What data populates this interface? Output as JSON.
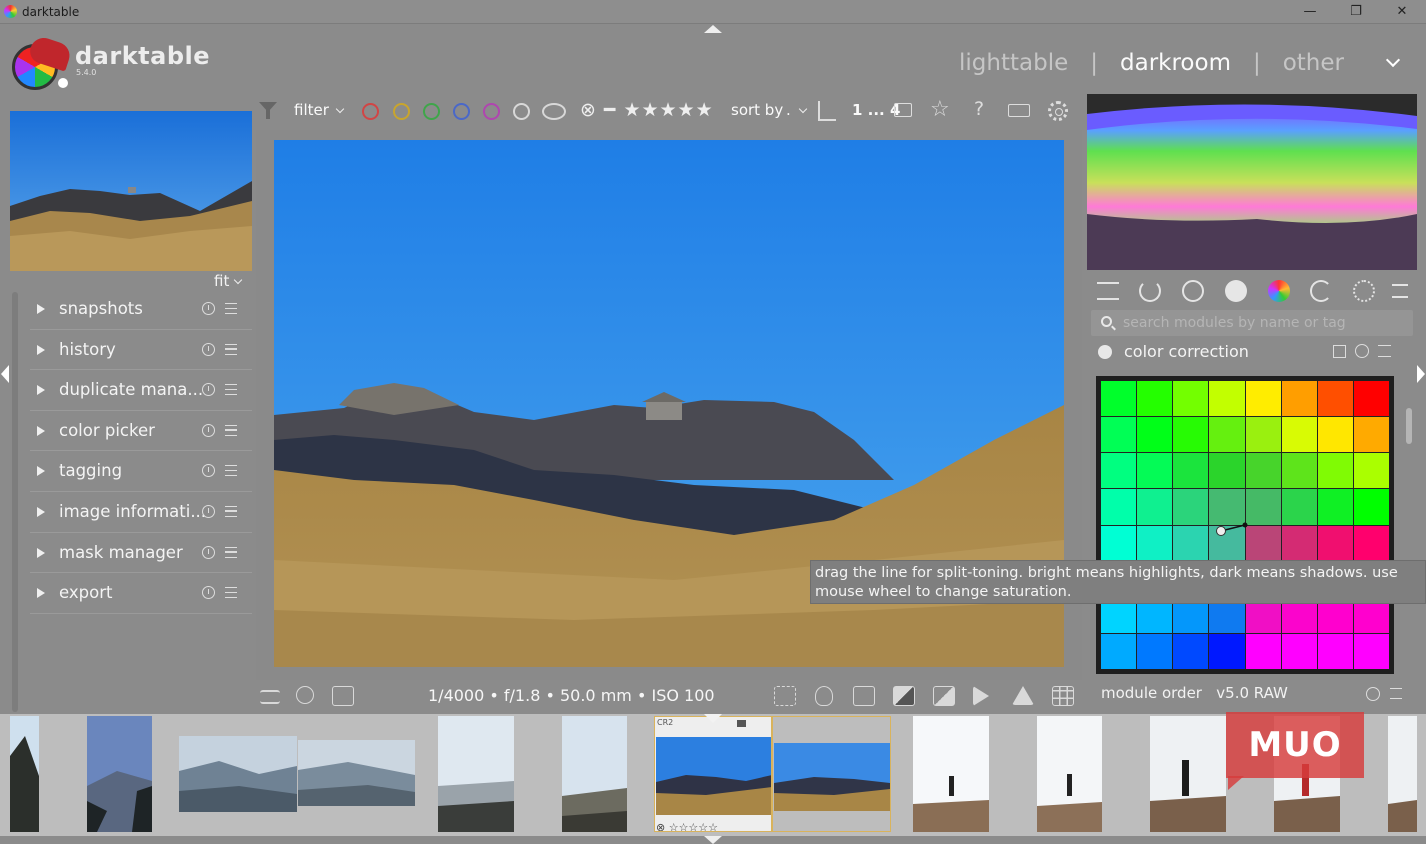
{
  "window": {
    "title": "darktable",
    "minimize": "—",
    "maximize": "❐",
    "close": "✕"
  },
  "header": {
    "brand": "darktable",
    "version": "5.4.0",
    "views": [
      "lighttable",
      "darkroom",
      "other"
    ],
    "active_view": "darkroom"
  },
  "left_panel": {
    "zoom_label": "fit",
    "modules": [
      {
        "label": "snapshots"
      },
      {
        "label": "history"
      },
      {
        "label": "duplicate mana..."
      },
      {
        "label": "color picker"
      },
      {
        "label": "tagging"
      },
      {
        "label": "image informati..."
      },
      {
        "label": "mask manager"
      },
      {
        "label": "export"
      }
    ]
  },
  "toolbar": {
    "filter_label": "filter",
    "color_labels": [
      "#d14545",
      "#c9a52c",
      "#3fa64a",
      "#4a68c9",
      "#b045b0",
      "#d8d8d8"
    ],
    "rating_stars": "⊗ ━ ★★★★★",
    "sort_label": "sort by",
    "sort_value": ".",
    "count": "1 ... 4",
    "help": "?"
  },
  "image_info": {
    "exif": "1/4000 • f/1.8 • 50.0 mm • ISO 100"
  },
  "right_panel": {
    "search_placeholder": "search modules by name or tag",
    "module_title": "color correction",
    "tooltip": "drag the line for split-toning. bright means highlights, dark means shadows. use mouse wheel to change saturation.",
    "module_order_label": "module order",
    "module_order_value": "v5.0 RAW"
  },
  "filmstrip": {
    "selected_badge": "CR2",
    "selected_stars": "⊗ ☆☆☆☆☆"
  },
  "watermark": "MUO"
}
